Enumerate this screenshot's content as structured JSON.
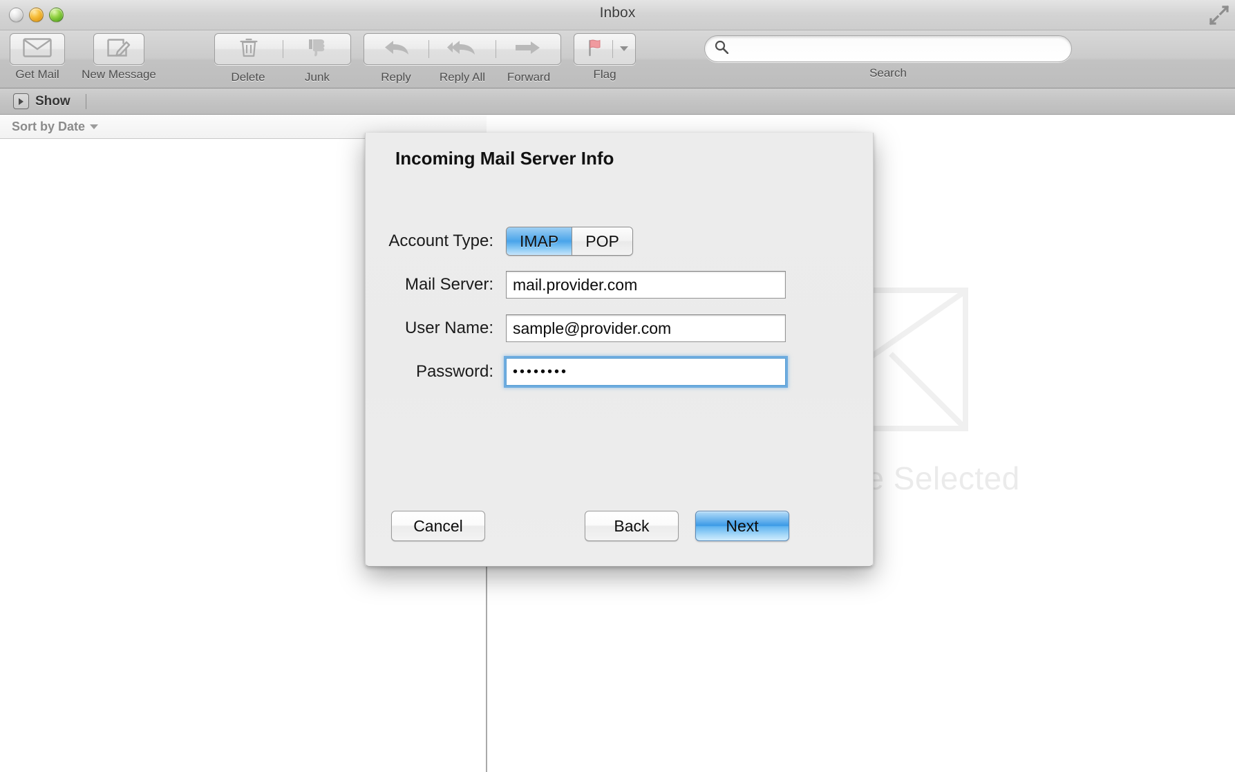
{
  "window": {
    "title": "Inbox",
    "traffic_lights": [
      "close",
      "minimize",
      "zoom"
    ],
    "fullscreen_icon": "fullscreen-arrows-icon"
  },
  "toolbar": {
    "items": [
      {
        "label": "Get Mail",
        "icon": "envelope-icon"
      },
      {
        "label": "New Message",
        "icon": "compose-pencil-icon"
      },
      {
        "label": "Delete",
        "icon": "trash-icon"
      },
      {
        "label": "Junk",
        "icon": "thumbs-down-icon"
      },
      {
        "label": "Reply",
        "icon": "reply-arrow-icon"
      },
      {
        "label": "Reply All",
        "icon": "reply-all-arrow-icon"
      },
      {
        "label": "Forward",
        "icon": "forward-arrow-icon"
      },
      {
        "label": "Flag",
        "icon": "flag-icon"
      }
    ],
    "search": {
      "placeholder": "",
      "value": "",
      "caption": "Search",
      "icon": "search-icon"
    }
  },
  "showbar": {
    "show_label": "Show",
    "show_icon": "disclosure-triangle-icon"
  },
  "message_list": {
    "sort_label": "Sort by Date",
    "sort_caret_icon": "chevron-down-icon",
    "rows": []
  },
  "preview": {
    "watermark_icon": "large-envelope-watermark-icon",
    "watermark_text": "No Message Selected"
  },
  "sheet": {
    "title": "Incoming Mail Server Info",
    "fields": {
      "account_type": {
        "label": "Account Type:",
        "options": [
          "IMAP",
          "POP"
        ],
        "selected": "IMAP"
      },
      "mail_server": {
        "label": "Mail Server:",
        "value": "mail.provider.com",
        "placeholder": ""
      },
      "user_name": {
        "label": "User Name:",
        "value": "sample@provider.com",
        "placeholder": ""
      },
      "password": {
        "label": "Password:",
        "value": "••••••••",
        "placeholder": "",
        "focused": true
      }
    },
    "buttons": {
      "cancel": "Cancel",
      "back": "Back",
      "next": "Next"
    }
  },
  "colors": {
    "accent_blue": "#3b9ae6",
    "selected_segment_blue": "#49a4ea",
    "focus_ring": "#69aade",
    "toolbar_gray": "#c6c6c6",
    "sheet_gray": "#ececec",
    "watermark_gray": "#ebebeb"
  }
}
